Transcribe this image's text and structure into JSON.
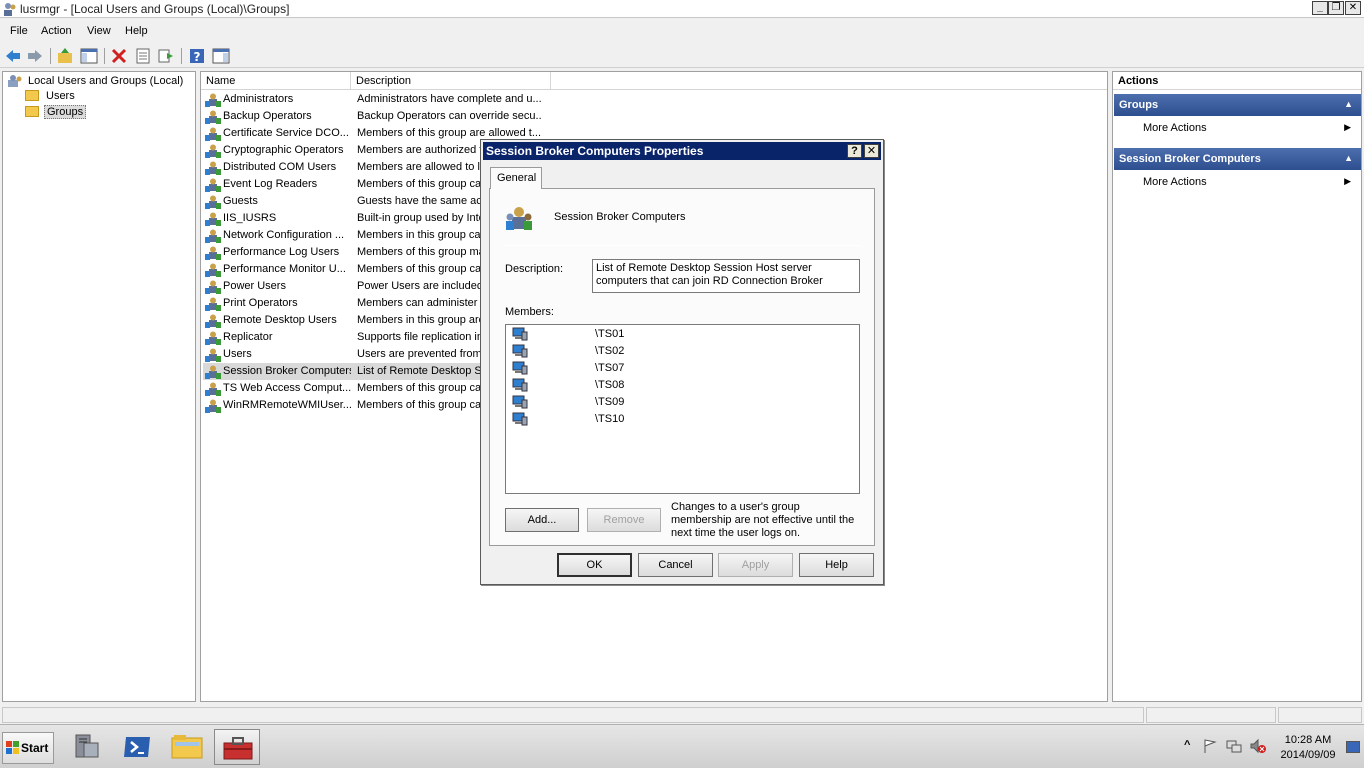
{
  "window": {
    "title": "lusrmgr - [Local Users and Groups (Local)\\Groups]"
  },
  "menu": {
    "items": [
      "File",
      "Action",
      "View",
      "Help"
    ]
  },
  "toolbar": {
    "icons": [
      "back-arrow-icon",
      "forward-arrow-icon",
      "up-folder-icon",
      "show-hide-tree-icon",
      "delete-icon",
      "properties-icon",
      "export-list-icon",
      "help-icon",
      "show-hide-action-pane-icon"
    ]
  },
  "tree": {
    "root": "Local Users and Groups (Local)",
    "items": [
      "Users",
      "Groups"
    ],
    "selected": "Groups"
  },
  "list": {
    "columns": [
      "Name",
      "Description"
    ],
    "rows": [
      {
        "name": "Administrators",
        "desc": "Administrators have complete and u..."
      },
      {
        "name": "Backup Operators",
        "desc": "Backup Operators can override secu..."
      },
      {
        "name": "Certificate Service DCO...",
        "desc": "Members of this group are allowed t..."
      },
      {
        "name": "Cryptographic Operators",
        "desc": "Members are authorized t"
      },
      {
        "name": "Distributed COM Users",
        "desc": "Members are allowed to la"
      },
      {
        "name": "Event Log Readers",
        "desc": "Members of this group car"
      },
      {
        "name": "Guests",
        "desc": "Guests have the same acc"
      },
      {
        "name": "IIS_IUSRS",
        "desc": "Built-in group used by Inte"
      },
      {
        "name": "Network Configuration ...",
        "desc": "Members in this group car"
      },
      {
        "name": "Performance Log Users",
        "desc": "Members of this group ma"
      },
      {
        "name": "Performance Monitor U...",
        "desc": "Members of this group car"
      },
      {
        "name": "Power Users",
        "desc": "Power Users are included"
      },
      {
        "name": "Print Operators",
        "desc": "Members can administer d"
      },
      {
        "name": "Remote Desktop Users",
        "desc": "Members in this group are"
      },
      {
        "name": "Replicator",
        "desc": "Supports file replication in"
      },
      {
        "name": "Users",
        "desc": "Users are prevented from"
      },
      {
        "name": "Session Broker Computers",
        "desc": "List of Remote Desktop Se"
      },
      {
        "name": "TS Web Access Comput...",
        "desc": "Members of this group car"
      },
      {
        "name": "WinRMRemoteWMIUser...",
        "desc": "Members of this group car"
      }
    ],
    "selected_index": 16
  },
  "actions": {
    "header": "Actions",
    "sections": [
      {
        "title": "Groups",
        "item": "More Actions"
      },
      {
        "title": "Session Broker Computers",
        "item": "More Actions"
      }
    ]
  },
  "dialog": {
    "title": "Session Broker Computers Properties",
    "help_glyph": "?",
    "close_glyph": "✕",
    "tab": "General",
    "group_name": "Session Broker Computers",
    "description_label": "Description:",
    "description_value": "List of Remote Desktop Session Host server computers that can join RD Connection Broker",
    "members_label": "Members:",
    "members": [
      "\\TS01",
      "\\TS02",
      "\\TS07",
      "\\TS08",
      "\\TS09",
      "\\TS10"
    ],
    "add_label": "Add...",
    "remove_label": "Remove",
    "note": "Changes to a user's group membership are not effective until the next time the user logs on.",
    "ok_label": "OK",
    "cancel_label": "Cancel",
    "apply_label": "Apply",
    "help_label": "Help"
  },
  "taskbar": {
    "start_label": "Start",
    "apps": [
      "server-manager-icon",
      "powershell-icon",
      "explorer-icon",
      "toolbox-icon"
    ],
    "tray_chevron": "^",
    "time": "10:28 AM",
    "date": "2014/09/09"
  },
  "colors": {
    "dialog_title": "#0a246a",
    "action_section": "#2e4f8f",
    "selection": "#d9d9d9"
  }
}
